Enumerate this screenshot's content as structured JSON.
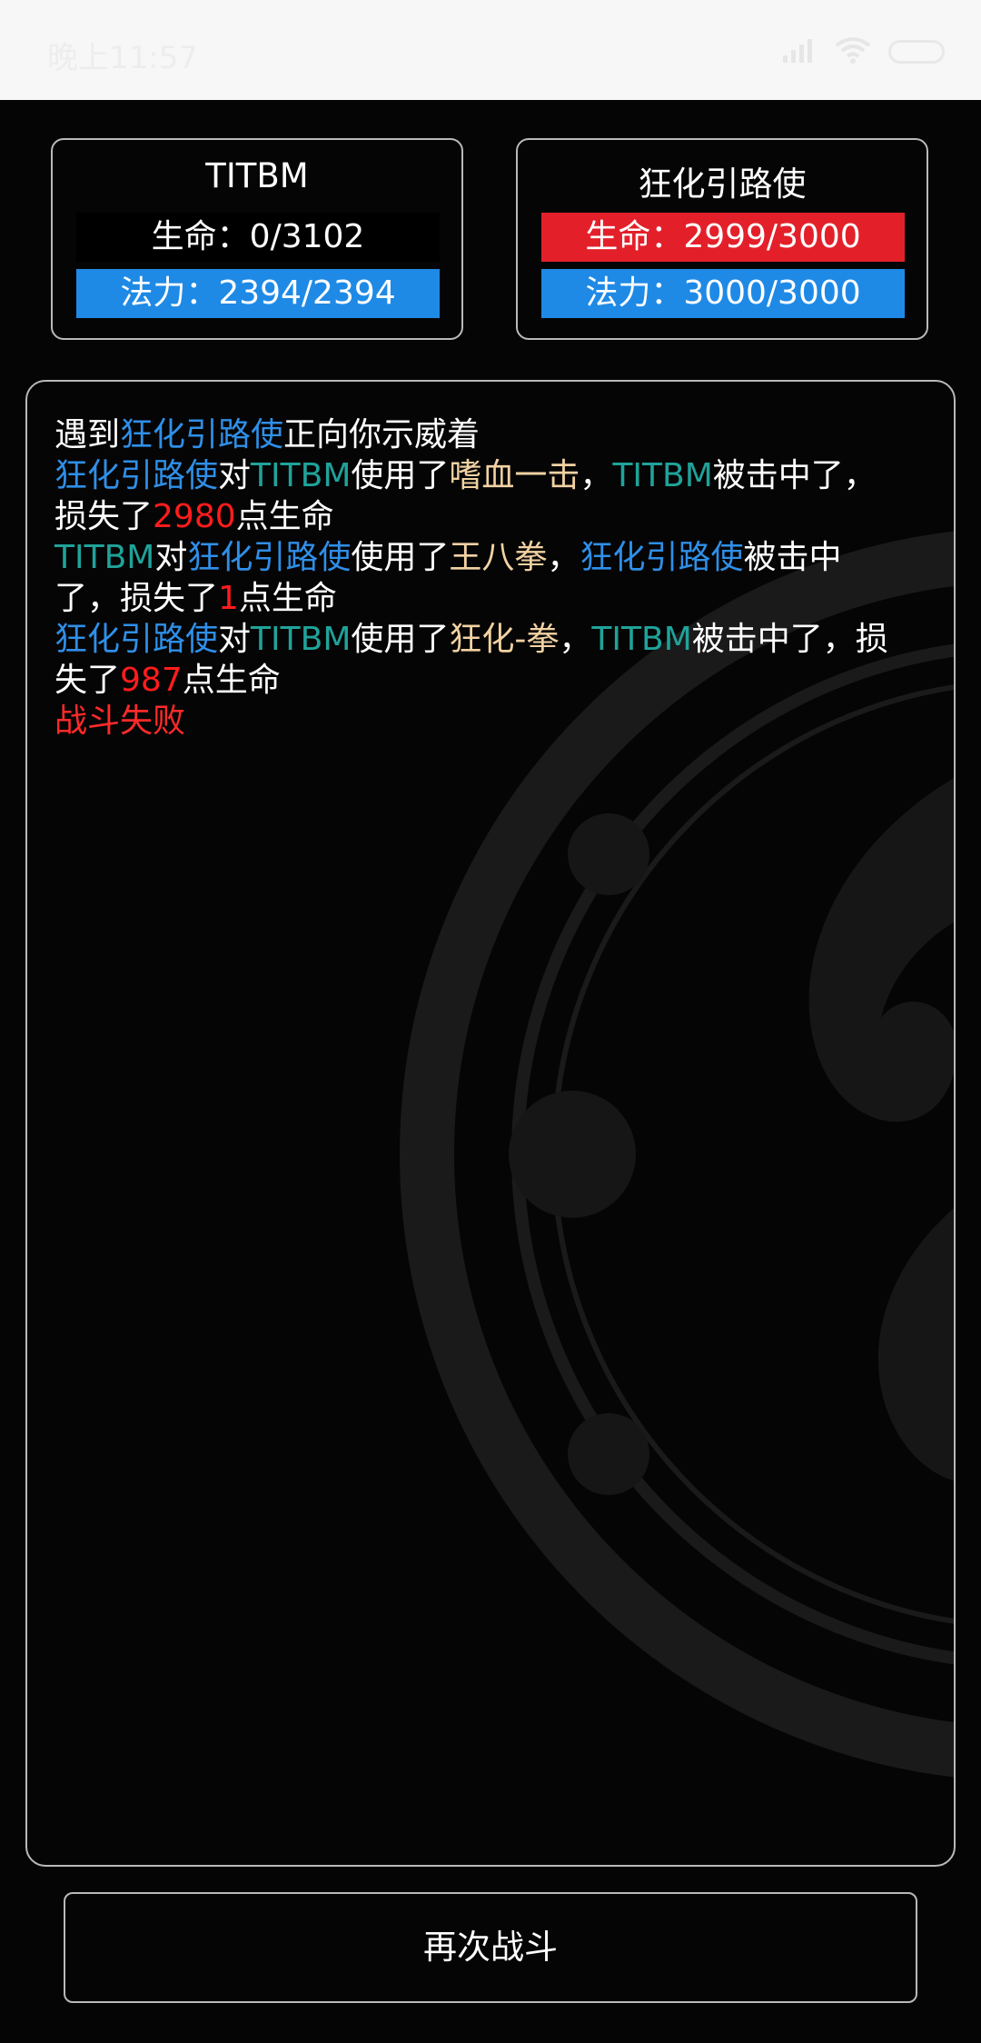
{
  "status_bar": {
    "time": "晚上11:57",
    "icons": [
      "signal-icon",
      "wifi-icon",
      "battery-icon"
    ]
  },
  "player": {
    "name": "TITBM",
    "hp_label": "生命：0/3102",
    "hp_fraction": 0.0,
    "mp_label": "法力：2394/2394",
    "mp_fraction": 1.0
  },
  "enemy": {
    "name": "狂化引路使",
    "hp_label": "生命：2999/3000",
    "hp_fraction": 0.9997,
    "mp_label": "法力：3000/3000",
    "mp_fraction": 1.0
  },
  "colors": {
    "enemy": "#2f8fe8",
    "player": "#1fa39a",
    "skill": "#f2d2a3",
    "damage": "#ff1c1c",
    "hp_bar": "#e3202a",
    "mp_bar": "#1f8ae6"
  },
  "battle_log": {
    "entry1": {
      "a": "遇到",
      "enemy": "狂化引路使",
      "b": "正向你示威着"
    },
    "entry2": {
      "actor": "狂化引路使",
      "a": "对",
      "target": "TITBM",
      "b": "使用了",
      "skill": "嗜血一击",
      "c": "，",
      "target2": "TITBM",
      "d": "被击中了，",
      "e": "损失了",
      "damage": "2980",
      "f": "点生命"
    },
    "entry3": {
      "actor": "TITBM",
      "a": "对",
      "target": "狂化引路使",
      "b": "使用了",
      "skill": "王八拳",
      "c": "，",
      "target2": "狂化引路使",
      "d": "被击中",
      "d2": "了，损失了",
      "damage": "1",
      "f": "点生命"
    },
    "entry4": {
      "actor": "狂化引路使",
      "a": "对",
      "target": "TITBM",
      "b": "使用了",
      "skill": "狂化-拳",
      "c": "，",
      "target2": "TITBM",
      "d": "被击中了，损",
      "e": "失了",
      "damage": "987",
      "f": "点生命"
    },
    "result": "战斗失败"
  },
  "fight_again_label": "再次战斗"
}
